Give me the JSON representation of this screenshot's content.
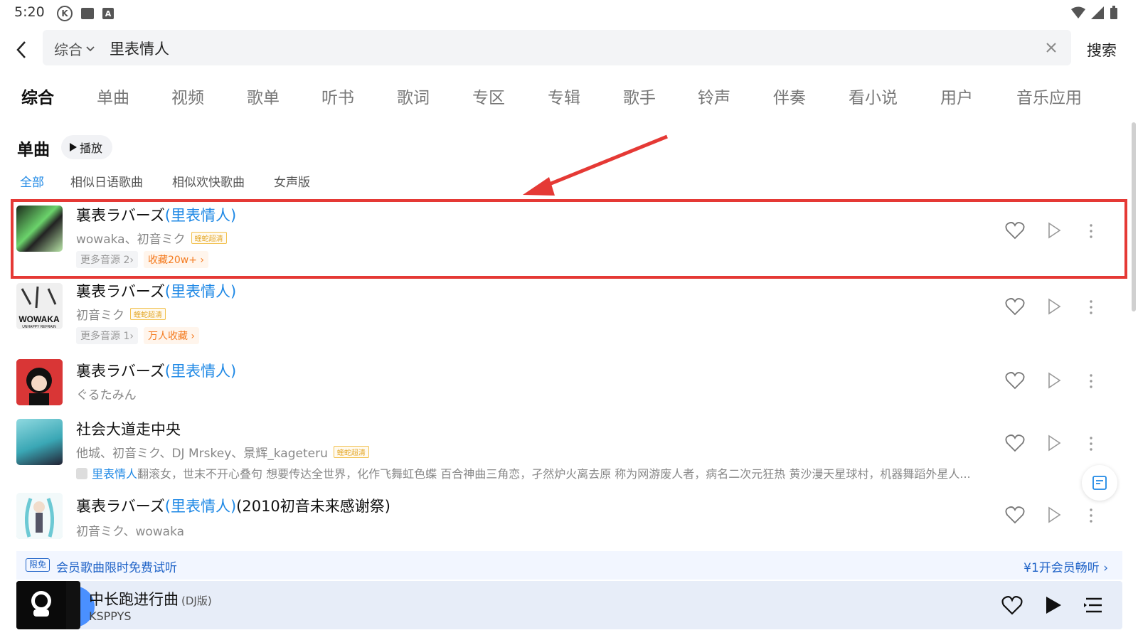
{
  "status": {
    "time": "5:20"
  },
  "search": {
    "scope": "综合",
    "query": "里表情人",
    "submit": "搜索"
  },
  "tabs": [
    "综合",
    "单曲",
    "视频",
    "歌单",
    "听书",
    "歌词",
    "专区",
    "专辑",
    "歌手",
    "铃声",
    "伴奏",
    "看小说",
    "用户",
    "音乐应用"
  ],
  "section": {
    "title": "单曲",
    "play_label": "播放"
  },
  "filters": [
    "全部",
    "相似日语歌曲",
    "相似欢快歌曲",
    "女声版"
  ],
  "songs": [
    {
      "title": "裏表ラバーズ",
      "hl": "里表情人",
      "suffix": "",
      "artist": "wowaka、初音ミク",
      "quality": "蝰蛇超清",
      "more_src": "更多音源 2›",
      "fav": "收藏20w+ ›"
    },
    {
      "title": "裏表ラバーズ",
      "hl": "里表情人",
      "suffix": "",
      "artist": "初音ミク",
      "quality": "蝰蛇超清",
      "more_src": "更多音源 1›",
      "fav": "万人收藏 ›"
    },
    {
      "title": "裏表ラバーズ",
      "hl": "里表情人",
      "suffix": "",
      "artist": "ぐるたみん"
    },
    {
      "title": "社会大道走中央",
      "artist": "他城、初音ミク、DJ Mrskey、景辉_kageteru",
      "quality": "蝰蛇超清",
      "lyric_hl": "里表情人",
      "lyric": "翻滚女，世末不开心叠句 想要传达全世界，化作飞舞虹色蝶 百合神曲三角恋，孑然炉火离去原 称为网游废人者，病名二次元狂热 黄沙漫天星球村，机器舞蹈外星人..."
    },
    {
      "title": "裏表ラバーズ",
      "hl": "里表情人",
      "suffix": "(2010初音未来感谢祭)",
      "artist": "初音ミク、wowaka"
    }
  ],
  "cover2_text": "WOWAKA",
  "cover2_sub": "UNHAPPY REFRAIN",
  "vip": {
    "badge": "限免",
    "text": "会员歌曲限时免费试听",
    "cta": "¥1开会员畅听 ›"
  },
  "player": {
    "title": "中长跑进行曲",
    "tag": "(DJ版)",
    "artist": "KSPPYS"
  },
  "colors": {
    "accent": "#1e88e5",
    "highlight_box": "#e53935",
    "fav_orange": "#f47b20",
    "vip_blue": "#1e62c7"
  }
}
